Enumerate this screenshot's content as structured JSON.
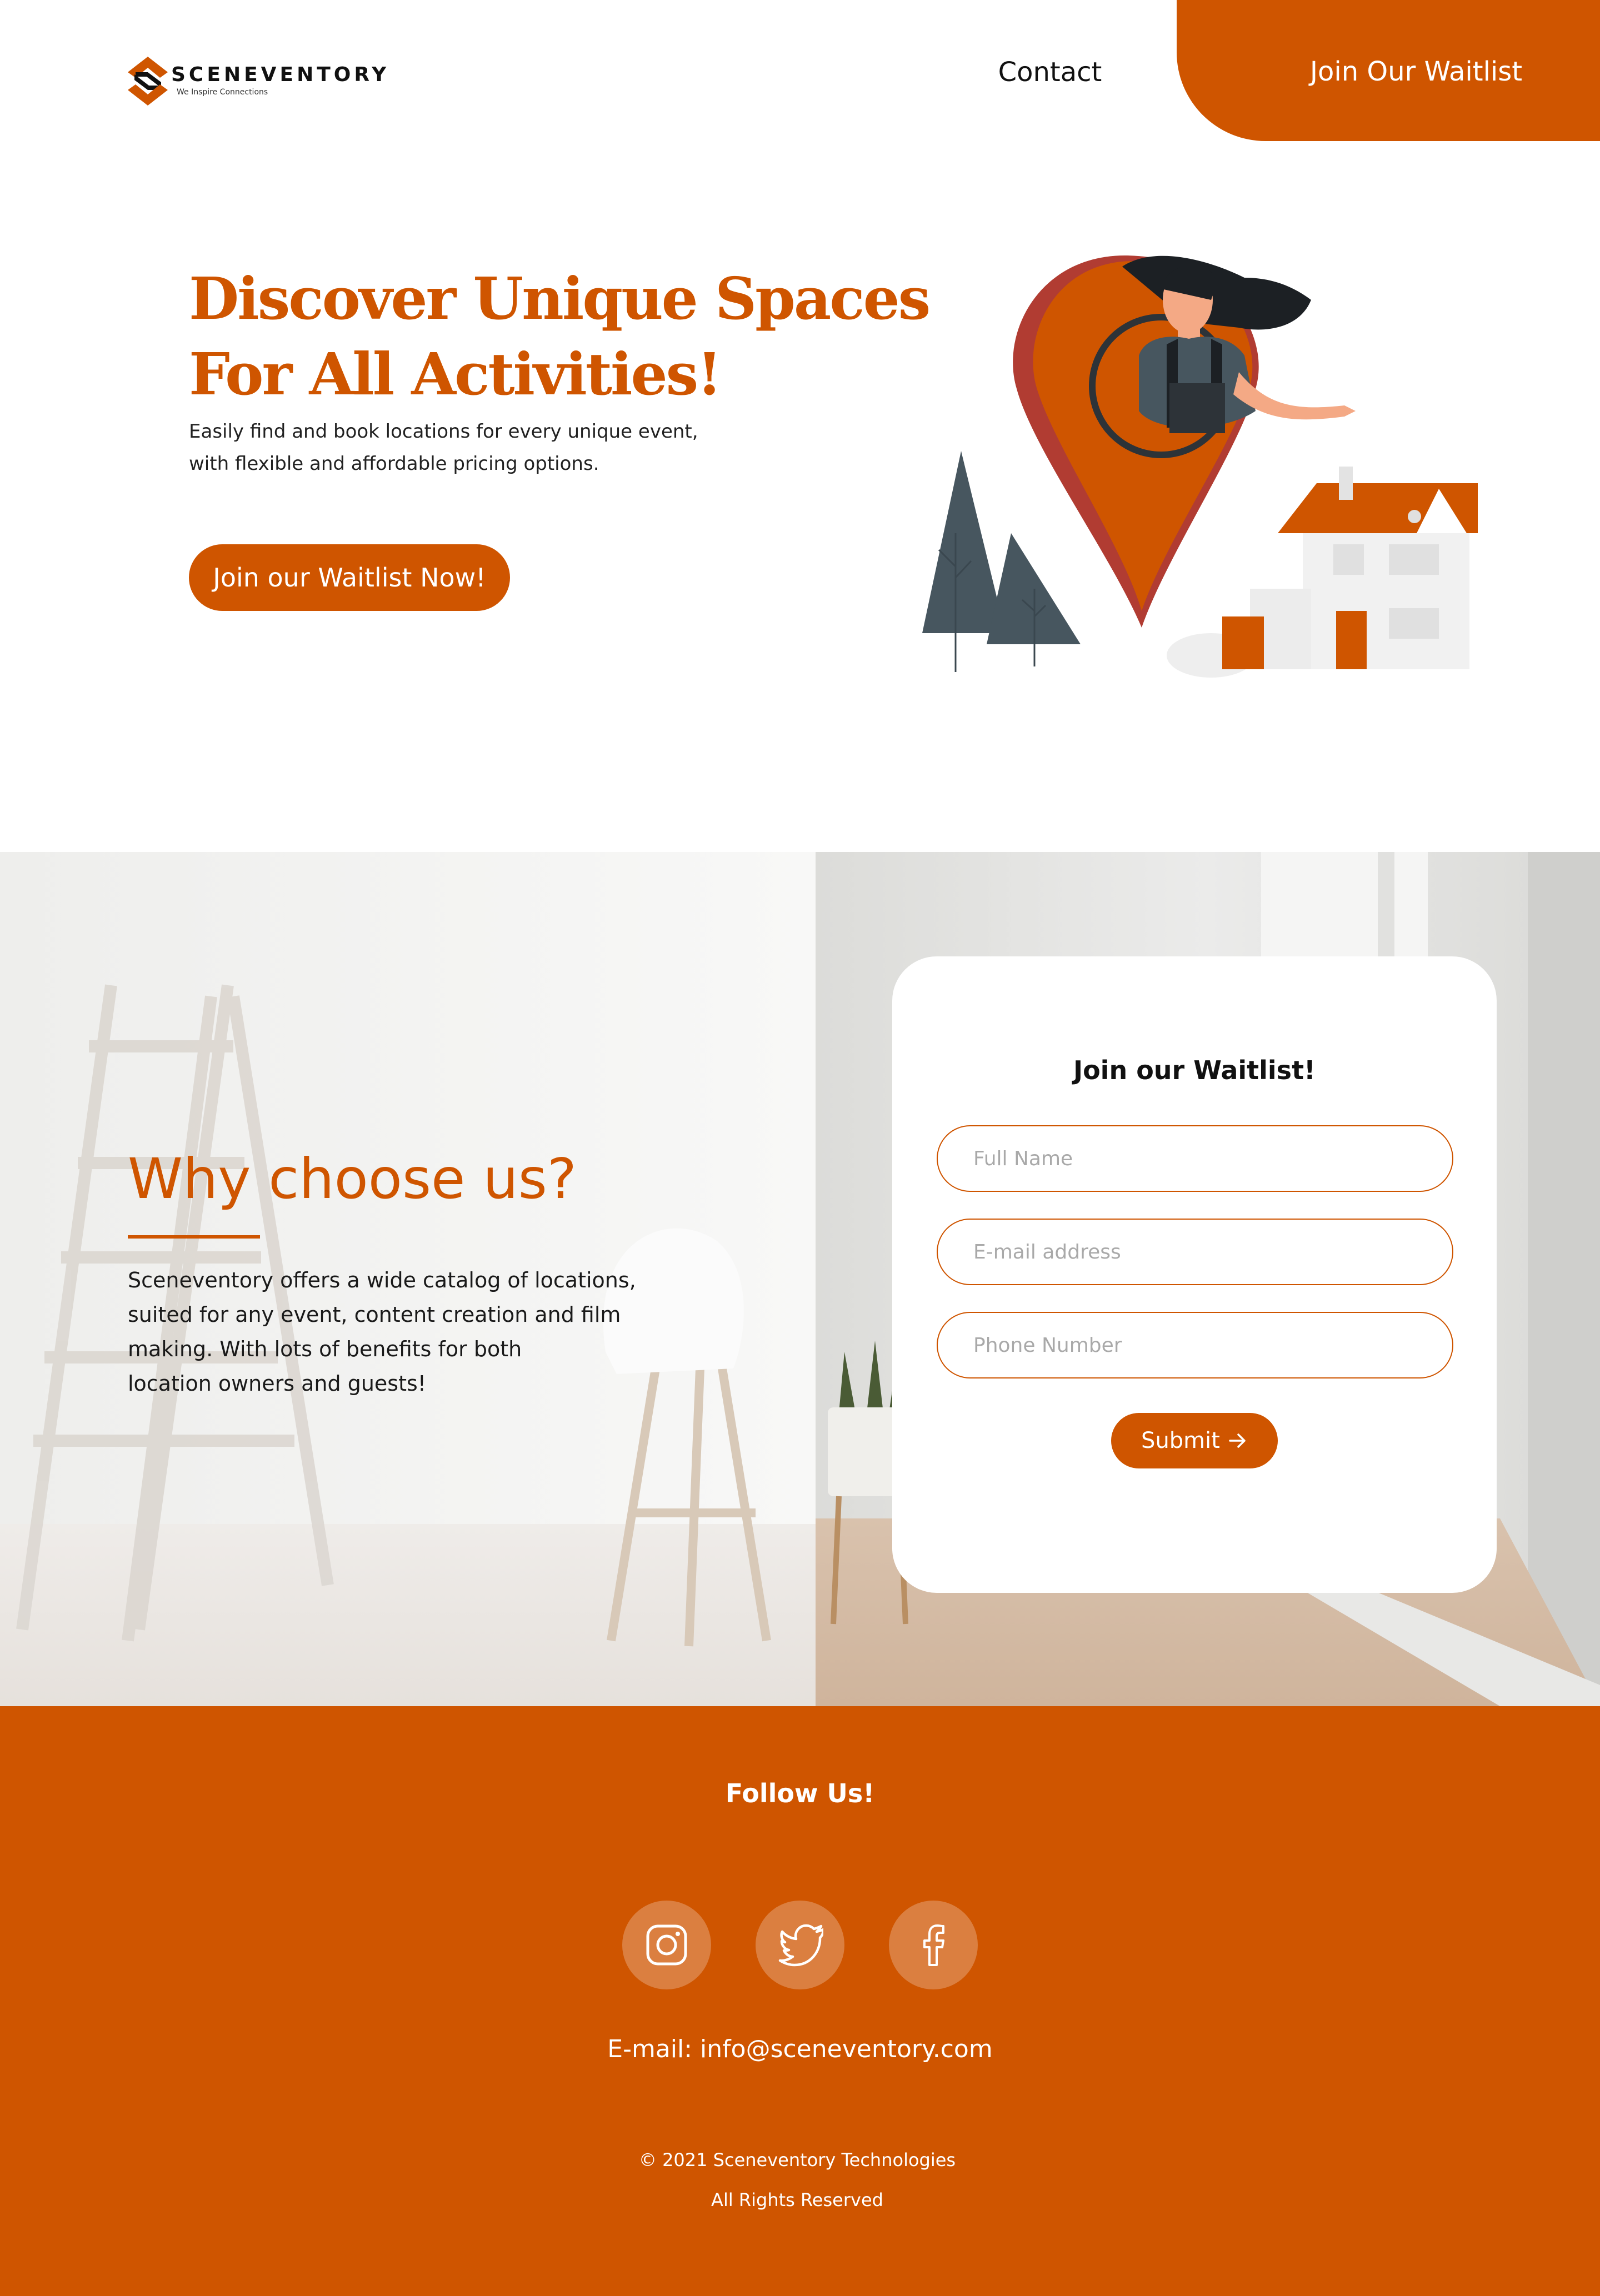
{
  "brand": {
    "name": "SCENEVENTORY",
    "tagline": "We Inspire Connections",
    "accent_color": "#cf5500",
    "logo_icon": "sceneventory-logo-icon"
  },
  "nav": {
    "contact_label": "Contact",
    "cta_label": "Join Our Waitlist"
  },
  "hero": {
    "title_line1": "Discover Unique Spaces",
    "title_line2": "For All Activities!",
    "desc_line1": "Easily find and book locations for every unique event,",
    "desc_line2": "with flexible and affordable pricing options.",
    "button_label": "Join our Waitlist Now!"
  },
  "why": {
    "title": "Why choose us?",
    "text_line1": "Sceneventory offers a wide catalog of locations,",
    "text_line2": "suited for any event, content creation and film",
    "text_line3": "making. With lots of benefits for both",
    "text_line4": "location owners and guests!"
  },
  "form": {
    "title": "Join our Waitlist!",
    "name_placeholder": "Full Name",
    "email_placeholder": "E-mail address",
    "phone_placeholder": "Phone Number",
    "submit_label": "Submit",
    "submit_icon": "arrow-right-icon"
  },
  "footer": {
    "follow_label": "Follow Us!",
    "social_icons": [
      "instagram-icon",
      "twitter-icon",
      "facebook-icon"
    ],
    "email_text": "E-mail: info@sceneventory.com",
    "copyright": "© 2021 Sceneventory Technologies",
    "rights": "All Rights Reserved"
  }
}
